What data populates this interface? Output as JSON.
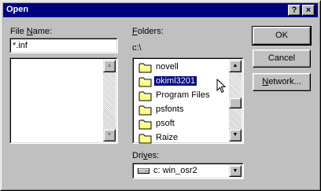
{
  "window": {
    "title": "Open",
    "help_button": "?",
    "close_button": "×"
  },
  "file_name": {
    "label_underlined": "N",
    "label_prefix": "File ",
    "label_suffix": "ame:",
    "value": "*.inf"
  },
  "folders": {
    "label_underlined": "F",
    "label_rest": "olders:",
    "current_path": "c:\\",
    "items": [
      {
        "name": "novell"
      },
      {
        "name": "okiml3201",
        "selected": true
      },
      {
        "name": "Program Files"
      },
      {
        "name": "psfonts"
      },
      {
        "name": "psoft"
      },
      {
        "name": "Raize"
      }
    ]
  },
  "drives": {
    "label_underlined": "v",
    "label_prefix": "Dri",
    "label_suffix": "es:",
    "value": "c: win_osr2"
  },
  "buttons": {
    "ok": "OK",
    "cancel": "Cancel",
    "network_underlined": "N",
    "network_rest": "etwork..."
  },
  "icons": {
    "folder": "folder-icon",
    "drive": "hard-drive-icon",
    "scroll_up": "scroll-up-arrow",
    "scroll_down": "scroll-down-arrow",
    "dropdown": "dropdown-arrow",
    "cursor": "mouse-pointer"
  },
  "colors": {
    "title_bar": "#000080",
    "face": "#c0c0c0",
    "selection": "#000080",
    "folder": "#ffff80"
  }
}
